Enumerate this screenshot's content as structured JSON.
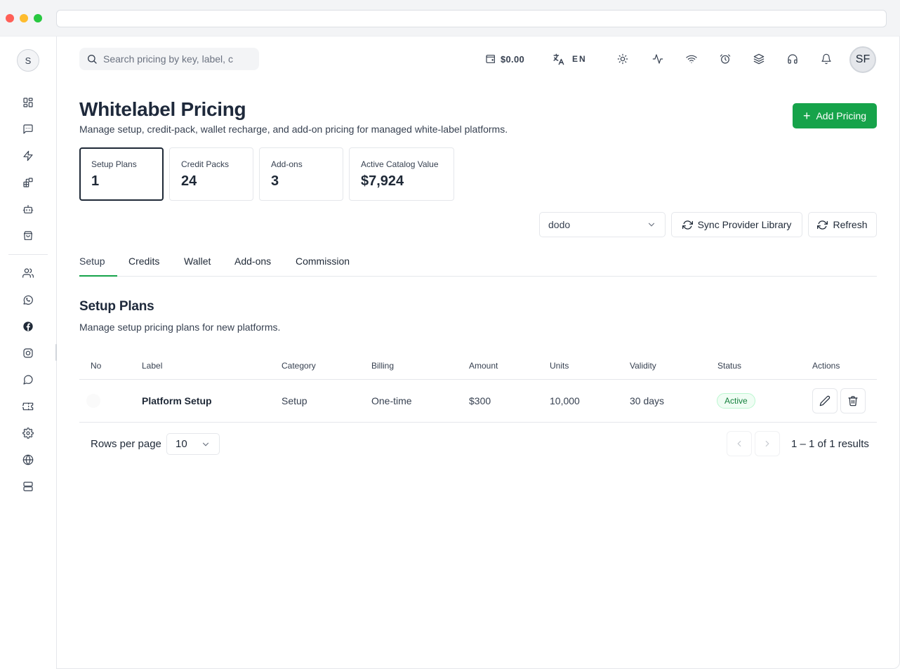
{
  "sidebar": {
    "avatar_initial": "S",
    "items": [
      {
        "name": "dashboard-icon"
      },
      {
        "name": "chat-icon"
      },
      {
        "name": "bolt-icon"
      },
      {
        "name": "widgets-icon"
      },
      {
        "name": "bot-icon"
      },
      {
        "name": "store-icon"
      },
      {
        "name": "users-icon"
      },
      {
        "name": "whatsapp-icon"
      },
      {
        "name": "facebook-icon"
      },
      {
        "name": "instagram-icon"
      },
      {
        "name": "message-icon"
      },
      {
        "name": "ticket-icon"
      },
      {
        "name": "gear-icon"
      },
      {
        "name": "globe-icon"
      },
      {
        "name": "server-icon"
      }
    ]
  },
  "topbar": {
    "search_placeholder": "Search pricing by key, label, c",
    "wallet_balance": "$0.00",
    "language": "EN",
    "user_initials": "SF",
    "icons": [
      "sun-icon",
      "activity-icon",
      "wifi-icon",
      "alarm-icon",
      "layers-icon",
      "headset-icon",
      "bell-icon"
    ]
  },
  "header": {
    "title": "Whitelabel Pricing",
    "subtitle": "Manage setup, credit-pack, wallet recharge, and add-on pricing for managed white-label platforms.",
    "add_button": "Add Pricing"
  },
  "stats": [
    {
      "label": "Setup Plans",
      "value": "1"
    },
    {
      "label": "Credit Packs",
      "value": "24"
    },
    {
      "label": "Add-ons",
      "value": "3"
    },
    {
      "label": "Active Catalog Value",
      "value": "$7,924"
    }
  ],
  "controls": {
    "provider_selected": "dodo",
    "sync_button": "Sync Provider Library",
    "refresh_button": "Refresh"
  },
  "tabs": [
    "Setup",
    "Credits",
    "Wallet",
    "Add-ons",
    "Commission"
  ],
  "section": {
    "title": "Setup Plans",
    "subtitle": "Manage setup pricing plans for new platforms."
  },
  "table": {
    "columns": [
      "No",
      "Label",
      "Category",
      "Billing",
      "Amount",
      "Units",
      "Validity",
      "Status",
      "Actions"
    ],
    "rows": [
      {
        "label": "Platform Setup",
        "category": "Setup",
        "billing": "One-time",
        "amount": "$300",
        "units": "10,000",
        "validity": "30 days",
        "status": "Active"
      }
    ]
  },
  "pagination": {
    "rows_per_page_label": "Rows per page",
    "rows_per_page": "10",
    "info": "1 – 1 of 1 results"
  },
  "colors": {
    "accent": "#16a34a",
    "badge_text": "#15803d"
  }
}
